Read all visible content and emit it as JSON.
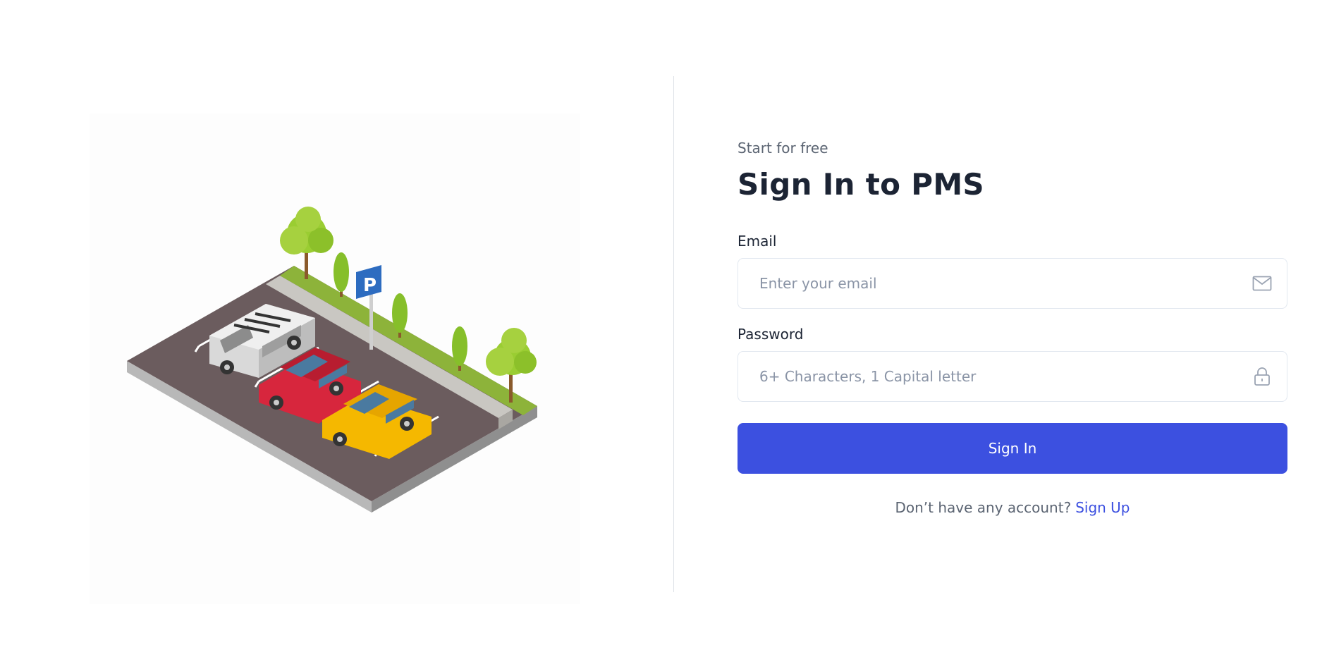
{
  "hero": {
    "image": "isometric-parking-lot-illustration",
    "sign_letter": "P"
  },
  "form": {
    "kicker": "Start for free",
    "title": "Sign In to PMS",
    "email": {
      "label": "Email",
      "placeholder": "Enter your email",
      "icon": "mail-icon"
    },
    "password": {
      "label": "Password",
      "placeholder": "6+ Characters, 1 Capital letter",
      "icon": "lock-icon"
    },
    "submit_label": "Sign In",
    "signup_prompt": "Don’t have any account?",
    "signup_link": "Sign Up"
  },
  "colors": {
    "primary": "#3c50e0",
    "heading": "#1c2434",
    "muted": "#5b6472",
    "border": "#e2e8f0"
  }
}
